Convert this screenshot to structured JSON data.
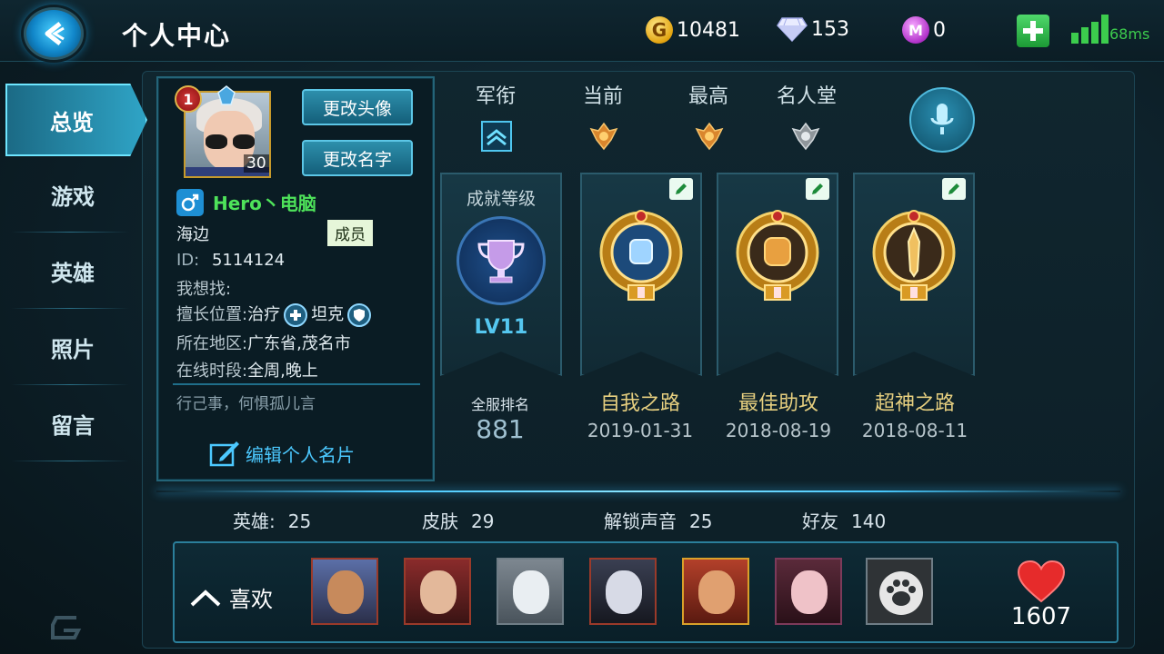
{
  "header": {
    "title": "个人中心",
    "gold": "10481",
    "diamonds": "153",
    "m_coins": "0",
    "ping": "68ms",
    "signal_bars": 4
  },
  "sidebar": {
    "items": [
      {
        "label": "总览",
        "active": true
      },
      {
        "label": "游戏",
        "active": false
      },
      {
        "label": "英雄",
        "active": false
      },
      {
        "label": "照片",
        "active": false
      },
      {
        "label": "留言",
        "active": false
      }
    ]
  },
  "profile": {
    "player_level": "1",
    "avatar_level": "30",
    "change_avatar_label": "更改头像",
    "change_name_label": "更改名字",
    "nickname": "Hero丶电脑",
    "location_name": "海边",
    "member_badge": "成员",
    "id_label": "ID:",
    "id_value": "5114124",
    "looking_for_label": "我想找:",
    "positions_label": "擅长位置:",
    "position_1": "治疗",
    "position_2": "坦克",
    "region_label": "所在地区:",
    "region_value": "广东省,茂名市",
    "online_label": "在线时段:",
    "online_value": "全周,晚上",
    "motto": "行己事，何惧孤儿言",
    "edit_card_label": "编辑个人名片"
  },
  "rank": {
    "headers": [
      "军衔",
      "当前",
      "最高",
      "名人堂"
    ]
  },
  "achievements": {
    "level_title": "成就等级",
    "level_value": "LV11",
    "server_rank_label": "全服排名",
    "server_rank_value": "881",
    "items": [
      {
        "name": "自我之路",
        "date": "2019-01-31"
      },
      {
        "name": "最佳助攻",
        "date": "2018-08-19"
      },
      {
        "name": "超神之路",
        "date": "2018-08-11"
      }
    ]
  },
  "stats": [
    {
      "label": "英雄:",
      "value": "25"
    },
    {
      "label": "皮肤",
      "value": "29"
    },
    {
      "label": "解锁声音",
      "value": "25"
    },
    {
      "label": "好友",
      "value": "140"
    }
  ],
  "favorites": {
    "label": "喜欢",
    "likes": "1607",
    "heroes": [
      "hero-1",
      "hero-2",
      "hero-3",
      "hero-4",
      "hero-5",
      "hero-6",
      "hero-7"
    ]
  },
  "colors": {
    "accent": "#49c9ff",
    "nickname": "#4ee35a",
    "achievement_name": "#e6cf7f",
    "ping": "#3ccc4d"
  }
}
